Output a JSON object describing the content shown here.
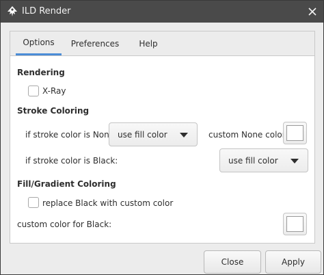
{
  "window": {
    "title": "ILD Render"
  },
  "tabs": [
    {
      "label": "Options",
      "active": true
    },
    {
      "label": "Preferences",
      "active": false
    },
    {
      "label": "Help",
      "active": false
    }
  ],
  "rendering": {
    "heading": "Rendering",
    "xray_label": "X-Ray",
    "xray_checked": false
  },
  "stroke": {
    "heading": "Stroke Coloring",
    "none_label": "if stroke color is None:",
    "none_value": "use fill color",
    "custom_none_label": "custom None color:",
    "black_label": "if stroke color is Black:",
    "black_value": "use fill color"
  },
  "fill": {
    "heading": "Fill/Gradient Coloring",
    "replace_label": "replace Black with custom color",
    "replace_checked": false,
    "custom_black_label": "custom color for Black:"
  },
  "buttons": {
    "close": "Close",
    "apply": "Apply"
  },
  "colors": {
    "titlebar": "#4a4a4a",
    "accent": "#4a8cd6",
    "swatch": "#ffffff"
  }
}
